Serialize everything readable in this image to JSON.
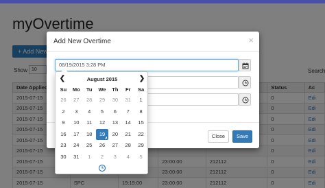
{
  "app": {
    "title": "myOvertime"
  },
  "toolbar": {
    "add_label": "+ Add New"
  },
  "list_controls": {
    "show_label": "Show",
    "page_size": "10",
    "search_label": "Search"
  },
  "table": {
    "headers": [
      "Date Applied",
      "",
      "",
      "",
      "",
      "Status",
      "Ac"
    ],
    "rows": [
      [
        "2015-07-15",
        "",
        "",
        "",
        "",
        "0",
        "Edi"
      ],
      [
        "2015-07-15",
        "",
        "",
        "",
        "",
        "0",
        "Edi"
      ],
      [
        "2015-07-15",
        "",
        "",
        "",
        "",
        "0",
        "Edi"
      ],
      [
        "2015-07-15",
        "",
        "",
        "",
        "",
        "0",
        "Edi"
      ],
      [
        "2015-07-15",
        "",
        "",
        "",
        "",
        "0",
        "Edi"
      ],
      [
        "2015-07-15",
        "",
        "",
        "",
        "",
        "0",
        "Edi"
      ],
      [
        "2015-07-15",
        "",
        "",
        "23:00:00",
        "212112",
        "0",
        "Edi"
      ],
      [
        "2015-07-15",
        "",
        "",
        "23:00:00",
        "212112",
        "0",
        "Edi"
      ],
      [
        "2015-07-15",
        "SPC",
        "19:19:00",
        "23:00:00",
        "212112",
        "0",
        "Edi"
      ]
    ]
  },
  "modal": {
    "title": "Add New Overtime",
    "close_glyph": "×",
    "date_value": "08/19/2015 3:28 PM",
    "close_label": "Close",
    "save_label": "Save"
  },
  "datepicker": {
    "month_label": "August 2015",
    "prev": "❮",
    "next": "❯",
    "weekdays": [
      "Su",
      "Mo",
      "Tu",
      "We",
      "Th",
      "Fr",
      "Sa"
    ],
    "weeks": [
      [
        "26",
        "27",
        "28",
        "29",
        "30",
        "31",
        "1"
      ],
      [
        "2",
        "3",
        "4",
        "5",
        "6",
        "7",
        "8"
      ],
      [
        "9",
        "10",
        "11",
        "12",
        "13",
        "14",
        "15"
      ],
      [
        "16",
        "17",
        "18",
        "19",
        "20",
        "21",
        "22"
      ],
      [
        "23",
        "24",
        "25",
        "26",
        "27",
        "28",
        "29"
      ],
      [
        "30",
        "31",
        "1",
        "2",
        "3",
        "4",
        "5"
      ]
    ],
    "selected_day": "19"
  },
  "colors": {
    "primary": "#337ab7",
    "header_bar": "#4a4fa8"
  }
}
